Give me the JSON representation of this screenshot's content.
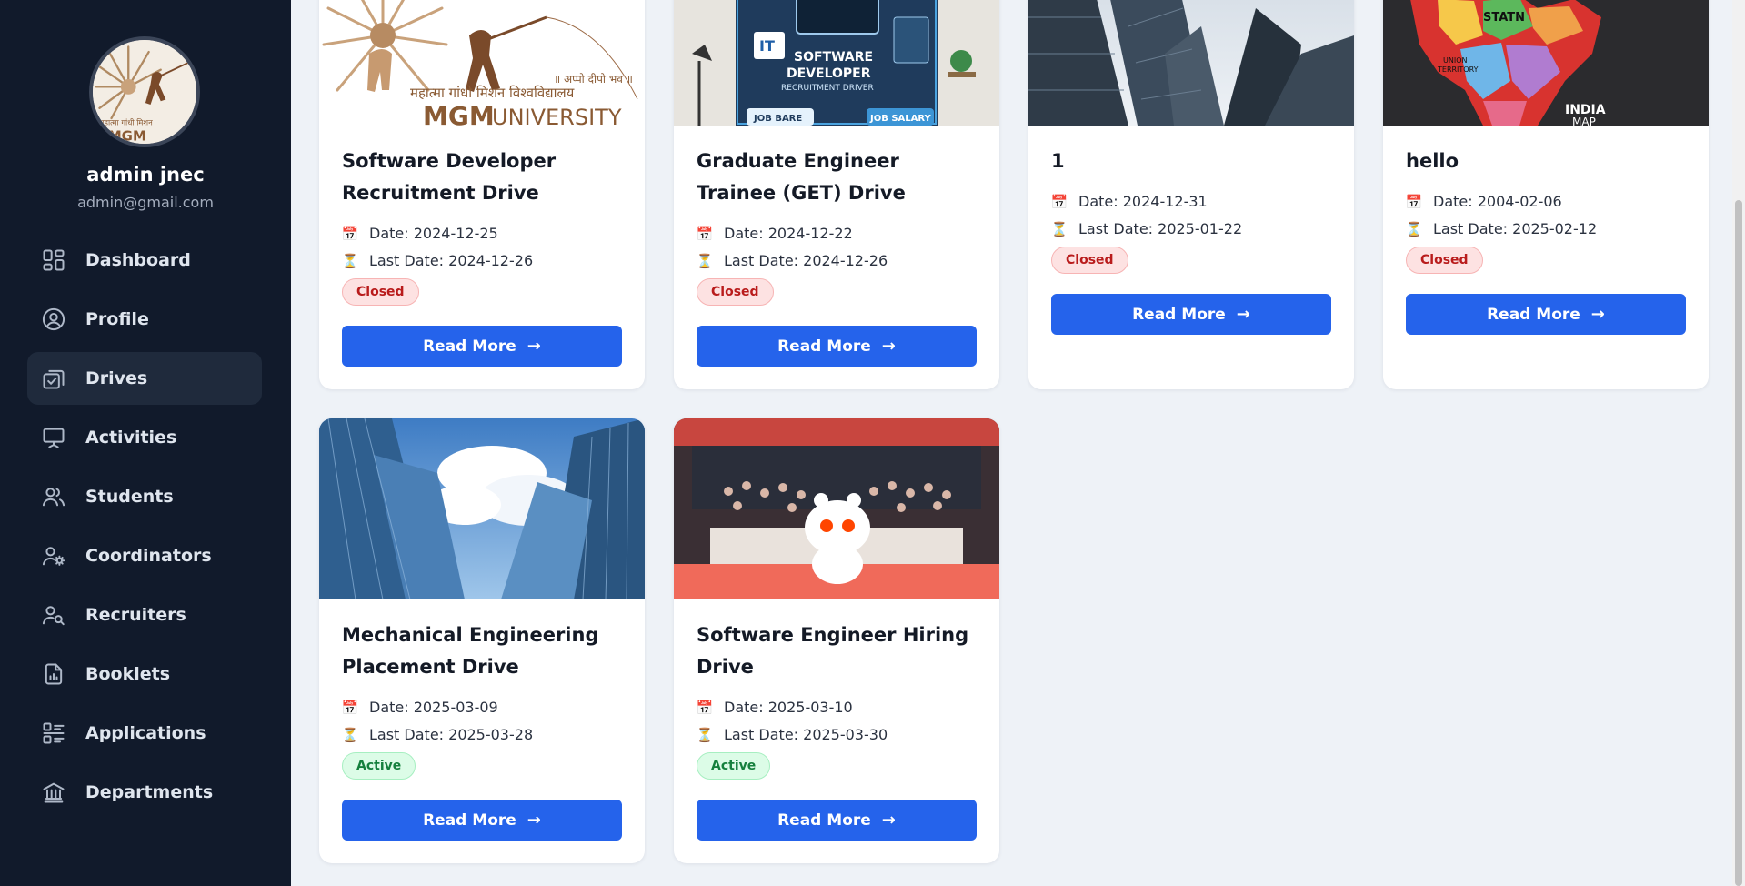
{
  "user": {
    "name": "admin jnec",
    "email": "admin@gmail.com"
  },
  "nav": [
    {
      "label": "Dashboard",
      "icon": "dashboard-icon",
      "active": false
    },
    {
      "label": "Profile",
      "icon": "profile-icon",
      "active": false
    },
    {
      "label": "Drives",
      "icon": "drives-icon",
      "active": true
    },
    {
      "label": "Activities",
      "icon": "activities-icon",
      "active": false
    },
    {
      "label": "Students",
      "icon": "students-icon",
      "active": false
    },
    {
      "label": "Coordinators",
      "icon": "coordinators-icon",
      "active": false
    },
    {
      "label": "Recruiters",
      "icon": "recruiters-icon",
      "active": false
    },
    {
      "label": "Booklets",
      "icon": "booklets-icon",
      "active": false
    },
    {
      "label": "Applications",
      "icon": "applications-icon",
      "active": false
    },
    {
      "label": "Departments",
      "icon": "departments-icon",
      "active": false
    }
  ],
  "drives": [
    {
      "title": "Software Developer Recruitment Drive",
      "date": "Date: 2024-12-25",
      "last_date": "Last Date: 2024-12-26",
      "status": "Closed",
      "button": "Read More",
      "image": "mgm-university-logo",
      "image_text": [
        "MGM UNIVERSITY",
        "महात्मा गांधी मिशन विश्वविद्यालय",
        "॥ अप्पो दीपो भव ॥"
      ]
    },
    {
      "title": "Graduate Engineer Trainee (GET) Drive",
      "date": "Date: 2024-12-22",
      "last_date": "Last Date: 2024-12-26",
      "status": "Closed",
      "button": "Read More",
      "image": "software-developer-poster",
      "image_text": [
        "SOFTWARE DEVELOPER",
        "RECRUITMENT DRIVE",
        "IT",
        "JOB BARE",
        "JOB SALARY"
      ]
    },
    {
      "title": "1",
      "date": "Date: 2024-12-31",
      "last_date": "Last Date: 2025-01-22",
      "status": "Closed",
      "button": "Read More",
      "image": "skyscrapers-photo",
      "image_text": []
    },
    {
      "title": "hello",
      "date": "Date: 2004-02-06",
      "last_date": "Last Date: 2025-02-12",
      "status": "Closed",
      "button": "Read More",
      "image": "india-map",
      "image_text": [
        "STATN",
        "UNION TERRITORY",
        "INDIA MAP"
      ]
    },
    {
      "title": "Mechanical Engineering Placement Drive",
      "date": "Date: 2025-03-09",
      "last_date": "Last Date: 2025-03-28",
      "status": "Active",
      "button": "Read More",
      "image": "glass-towers-photo",
      "image_text": []
    },
    {
      "title": "Software Engineer Hiring Drive",
      "date": "Date: 2025-03-10",
      "last_date": "Last Date: 2025-03-30",
      "status": "Active",
      "button": "Read More",
      "image": "stock-exchange-photo",
      "image_text": []
    }
  ],
  "colors": {
    "sidebar": "#111a2b",
    "primary": "#2563eb",
    "page_bg": "#eef2f7",
    "closed": "#b91c1c",
    "active": "#15803d"
  }
}
